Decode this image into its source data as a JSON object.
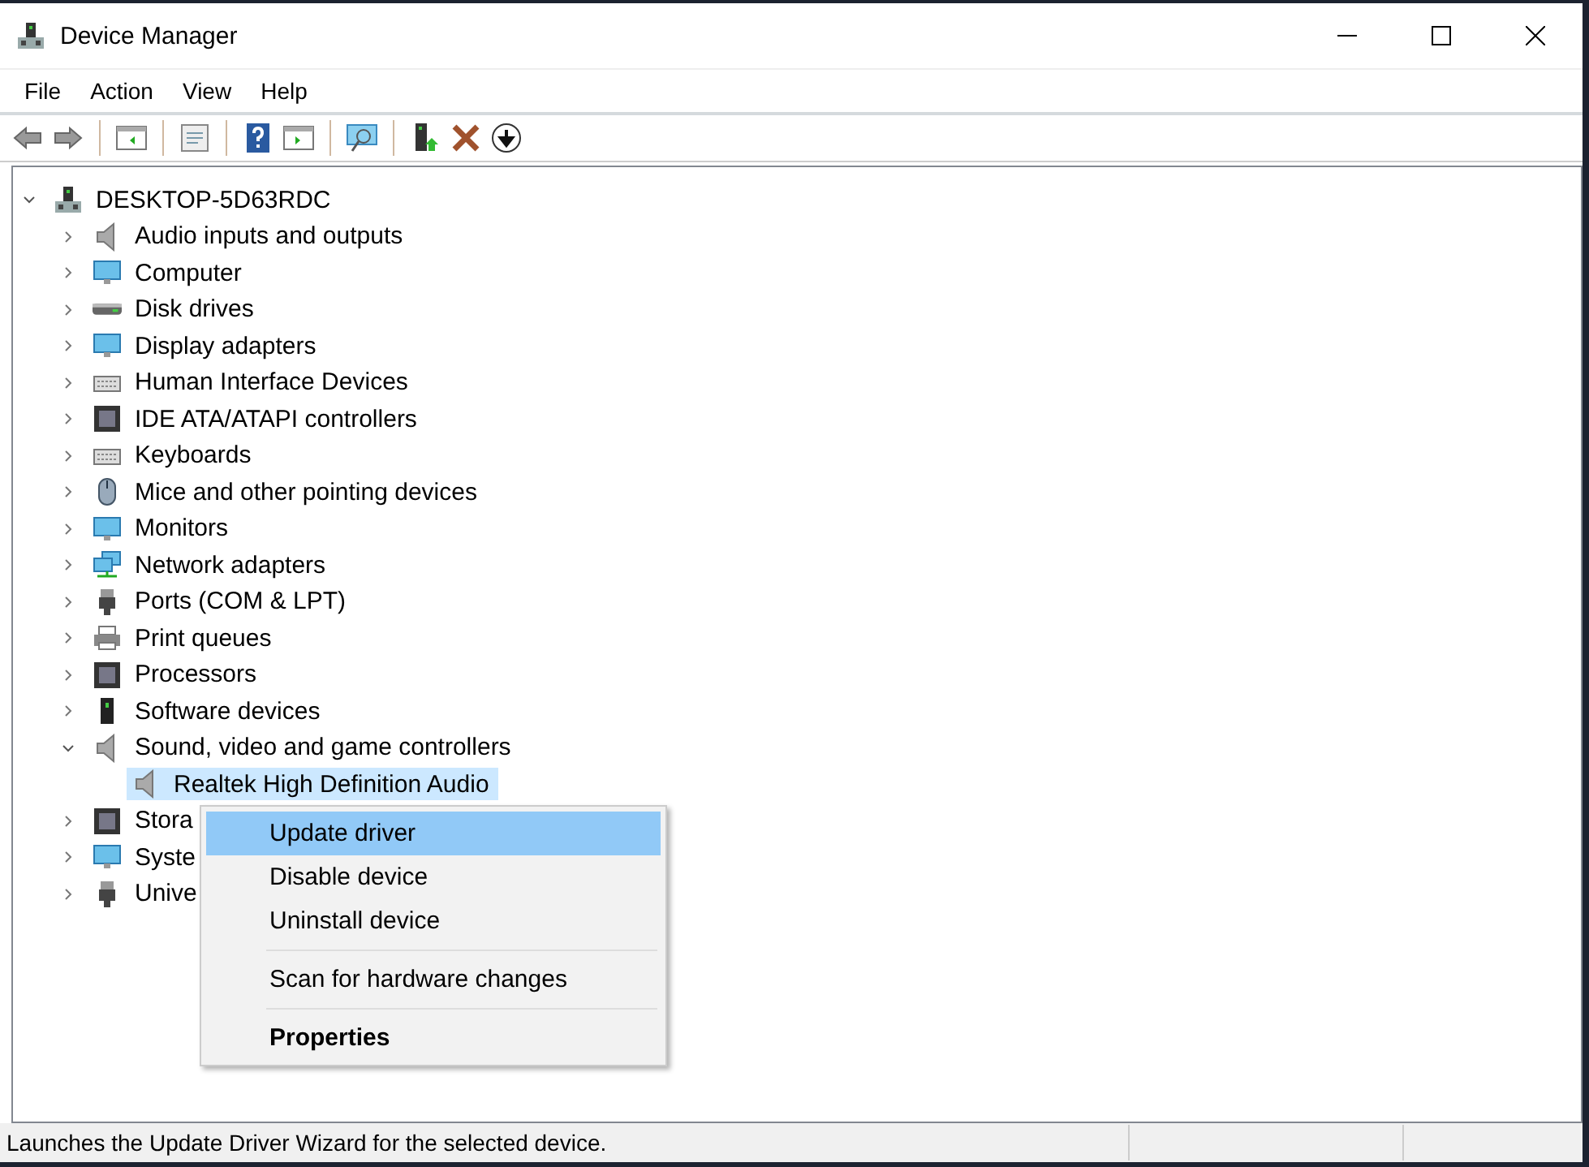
{
  "window": {
    "title": "Device Manager"
  },
  "menu": [
    "File",
    "Action",
    "View",
    "Help"
  ],
  "tree": {
    "label": "DESKTOP-5D63RDC",
    "expanded": true,
    "selected": false,
    "children": [
      {
        "label": "Audio inputs and outputs",
        "expanded": false,
        "selected": false
      },
      {
        "label": "Computer",
        "expanded": false,
        "selected": false
      },
      {
        "label": "Disk drives",
        "expanded": false,
        "selected": false
      },
      {
        "label": "Display adapters",
        "expanded": false,
        "selected": false
      },
      {
        "label": "Human Interface Devices",
        "expanded": false,
        "selected": false
      },
      {
        "label": "IDE ATA/ATAPI controllers",
        "expanded": false,
        "selected": false
      },
      {
        "label": "Keyboards",
        "expanded": false,
        "selected": false
      },
      {
        "label": "Mice and other pointing devices",
        "expanded": false,
        "selected": false
      },
      {
        "label": "Monitors",
        "expanded": false,
        "selected": false
      },
      {
        "label": "Network adapters",
        "expanded": false,
        "selected": false
      },
      {
        "label": "Ports (COM & LPT)",
        "expanded": false,
        "selected": false
      },
      {
        "label": "Print queues",
        "expanded": false,
        "selected": false
      },
      {
        "label": "Processors",
        "expanded": false,
        "selected": false
      },
      {
        "label": "Software devices",
        "expanded": false,
        "selected": false
      },
      {
        "label": "Sound, video and game controllers",
        "expanded": true,
        "selected": false,
        "children": [
          {
            "label": "Realtek High Definition Audio",
            "selected": true
          }
        ]
      },
      {
        "label": "Stora",
        "expanded": false,
        "selected": false
      },
      {
        "label": "Syste",
        "expanded": false,
        "selected": false
      },
      {
        "label": "Unive",
        "expanded": false,
        "selected": false
      }
    ]
  },
  "context_menu": {
    "items": [
      {
        "kind": "item",
        "label": "Update driver",
        "selected": true
      },
      {
        "kind": "item",
        "label": "Disable device",
        "selected": false
      },
      {
        "kind": "item",
        "label": "Uninstall device",
        "selected": false
      },
      {
        "kind": "separator"
      },
      {
        "kind": "item",
        "label": "Scan for hardware changes",
        "selected": false
      },
      {
        "kind": "separator"
      },
      {
        "kind": "default",
        "label": "Properties",
        "selected": false
      }
    ]
  },
  "status_bar": {
    "text": "Launches the Update Driver Wizard for the selected device."
  }
}
